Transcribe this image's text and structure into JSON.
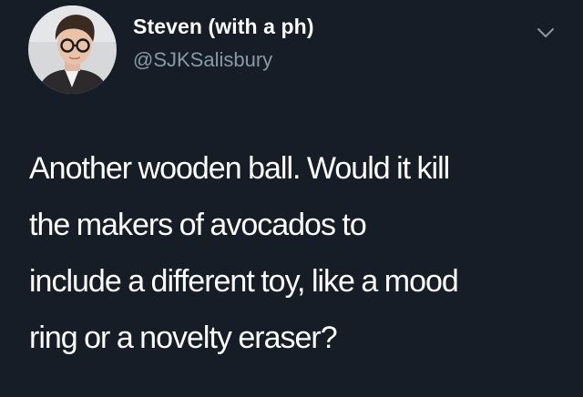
{
  "tweet": {
    "author": {
      "display_name": "Steven (with a ph)",
      "handle": "@SJKSalisbury",
      "avatar_icon": "profile-photo"
    },
    "menu_icon": "chevron-down-icon",
    "text_lines": [
      "Another wooden ball. Would it kill",
      "the makers of avocados to",
      "include a different toy, like a mood",
      "ring or a novelty eraser?"
    ]
  },
  "colors": {
    "background": "#161d27",
    "text": "#ffffff",
    "secondary_text": "#8899a6"
  }
}
